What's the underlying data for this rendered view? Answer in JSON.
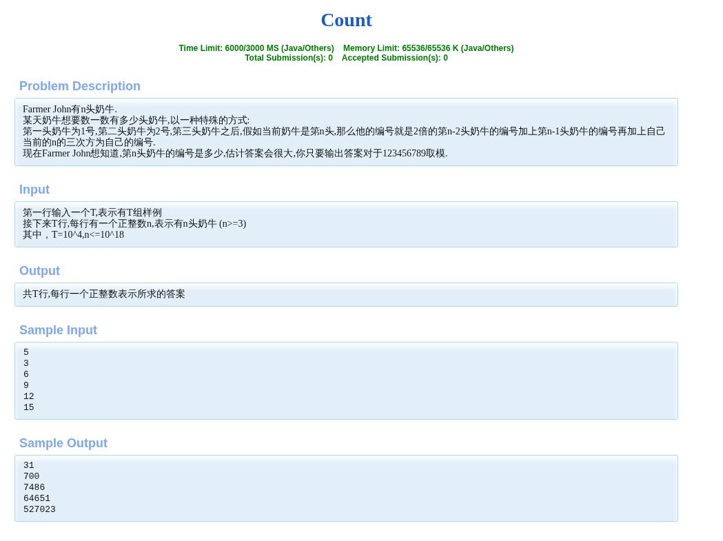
{
  "title": "Count",
  "limits": [
    "Time Limit: 6000/3000 MS (Java/Others)    Memory Limit: 65536/65536 K (Java/Others)",
    "Total Submission(s): 0    Accepted Submission(s): 0"
  ],
  "sections": [
    {
      "heading": "Problem Description",
      "kind": "text",
      "lines": [
        "Farmer John有n头奶牛.",
        "某天奶牛想要数一数有多少头奶牛,以一种特殊的方式:",
        "第一头奶牛为1号,第二头奶牛为2号,第三头奶牛之后,假如当前奶牛是第n头,那么他的编号就是2倍的第n-2头奶牛的编号加上第n-1头奶牛的编号再加上自己",
        "当前的n的三次方为自己的编号.",
        "现在Farmer John想知道,第n头奶牛的编号是多少,估计答案会很大,你只要输出答案对于123456789取模."
      ]
    },
    {
      "heading": "Input",
      "kind": "text",
      "lines": [
        "第一行输入一个T,表示有T组样例",
        "接下来T行,每行有一个正整数n,表示有n头奶牛 (n>=3)",
        "其中，T=10^4,n<=10^18"
      ]
    },
    {
      "heading": "Output",
      "kind": "text",
      "lines": [
        "共T行,每行一个正整数表示所求的答案"
      ]
    },
    {
      "heading": "Sample Input",
      "kind": "code",
      "lines": [
        "5",
        "3",
        "6",
        "9",
        "12",
        "15"
      ]
    },
    {
      "heading": "Sample Output",
      "kind": "code",
      "lines": [
        "31",
        "700",
        "7486",
        "64651",
        "527023"
      ]
    }
  ]
}
